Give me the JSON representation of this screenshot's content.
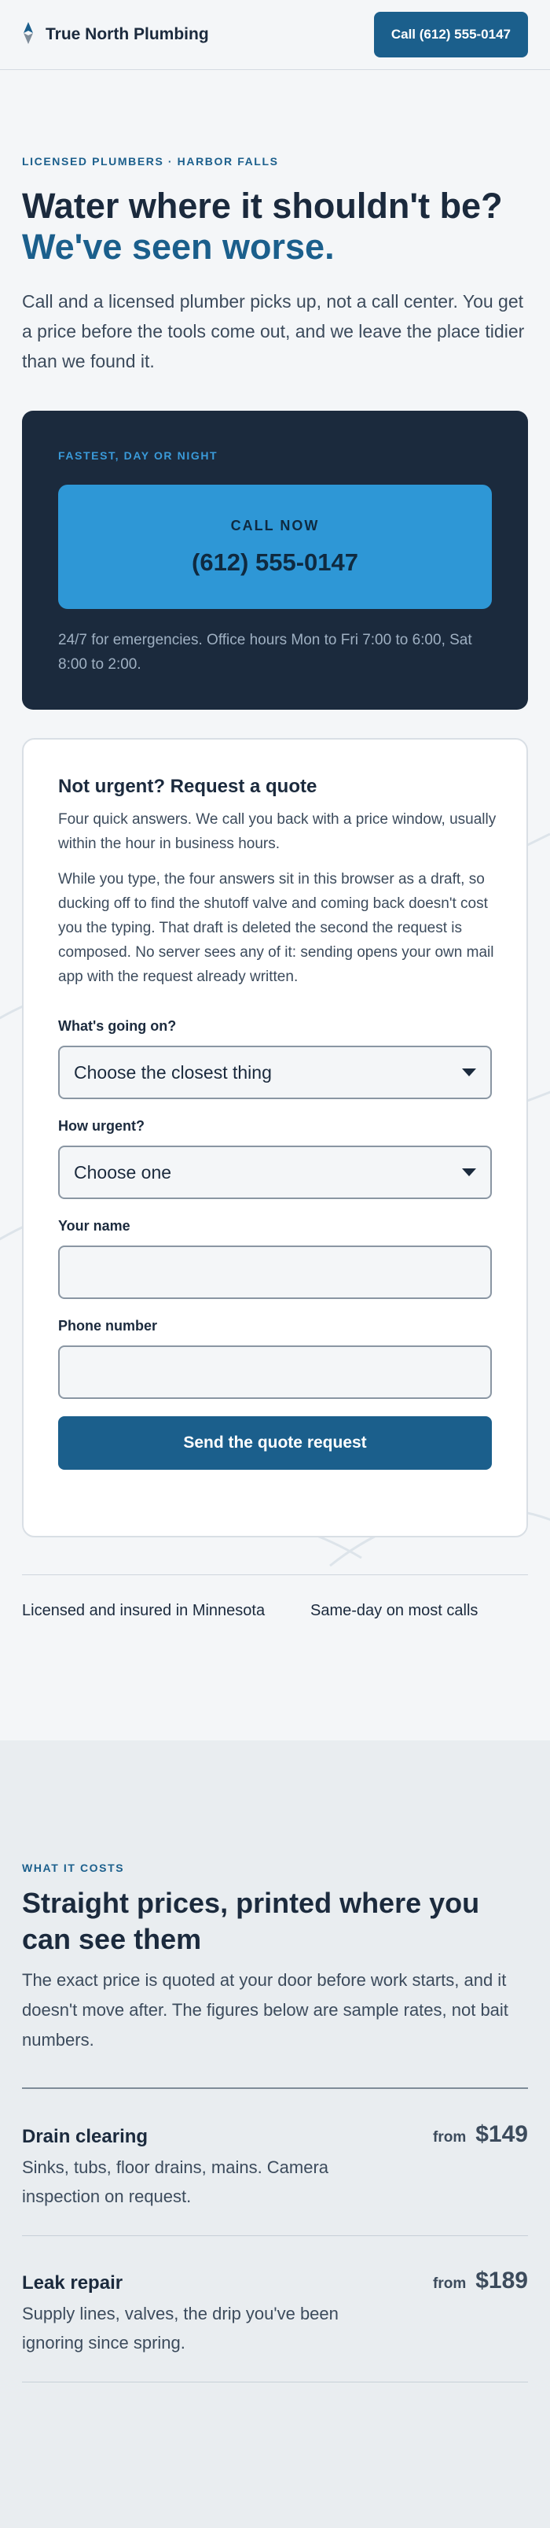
{
  "header": {
    "brand_name": "True North Plumbing",
    "call_button": "Call (612) 555-0147"
  },
  "hero": {
    "eyebrow": "LICENSED PLUMBERS · HARBOR FALLS",
    "title_line1": "Water where it shouldn't be?",
    "title_line2": "We've seen worse.",
    "lede": "Call and a licensed plumber picks up, not a call center. You get a price before the tools come out, and we leave the place tidier than we found it."
  },
  "call_panel": {
    "eyebrow": "FASTEST, DAY OR NIGHT",
    "call_label": "CALL NOW",
    "phone": "(612) 555-0147",
    "hours": "24/7 for emergencies. Office hours Mon to Fri 7:00 to 6:00, Sat 8:00 to 2:00."
  },
  "quote_form": {
    "title": "Not urgent? Request a quote",
    "intro": "Four quick answers. We call you back with a price window, usually within the hour in business hours.",
    "privacy_note": "While you type, the four answers sit in this browser as a draft, so ducking off to find the shutoff valve and coming back doesn't cost you the typing. That draft is deleted the second the request is composed. No server sees any of it: sending opens your own mail app with the request already written.",
    "issue_label": "What's going on?",
    "issue_value": "Choose the closest thing",
    "urgency_label": "How urgent?",
    "urgency_value": "Choose one",
    "name_label": "Your name",
    "name_value": "",
    "phone_label": "Phone number",
    "phone_value": "",
    "submit_label": "Send the quote request"
  },
  "trust": {
    "item1": "Licensed and insured in Minnesota",
    "item2": "Same-day on most calls"
  },
  "pricing": {
    "eyebrow": "WHAT IT COSTS",
    "title": "Straight prices, printed where you can see them",
    "lede": "The exact price is quoted at your door before work starts, and it doesn't move after. The figures below are sample rates, not bait numbers.",
    "services": [
      {
        "name": "Drain clearing",
        "description": "Sinks, tubs, floor drains, mains. Camera inspection on request.",
        "from_label": "from",
        "price": "$149"
      },
      {
        "name": "Leak repair",
        "description": "Supply lines, valves, the drip you've been ignoring since spring.",
        "from_label": "from",
        "price": "$189"
      }
    ]
  },
  "colors": {
    "accent": "#1b5f8c",
    "accent_bright": "#2e97d6",
    "navy": "#1b2a3d",
    "page_bg": "#f4f6f8"
  },
  "icons": {
    "brand": "compass-needle-icon",
    "dropdown": "chevron-down-icon"
  }
}
